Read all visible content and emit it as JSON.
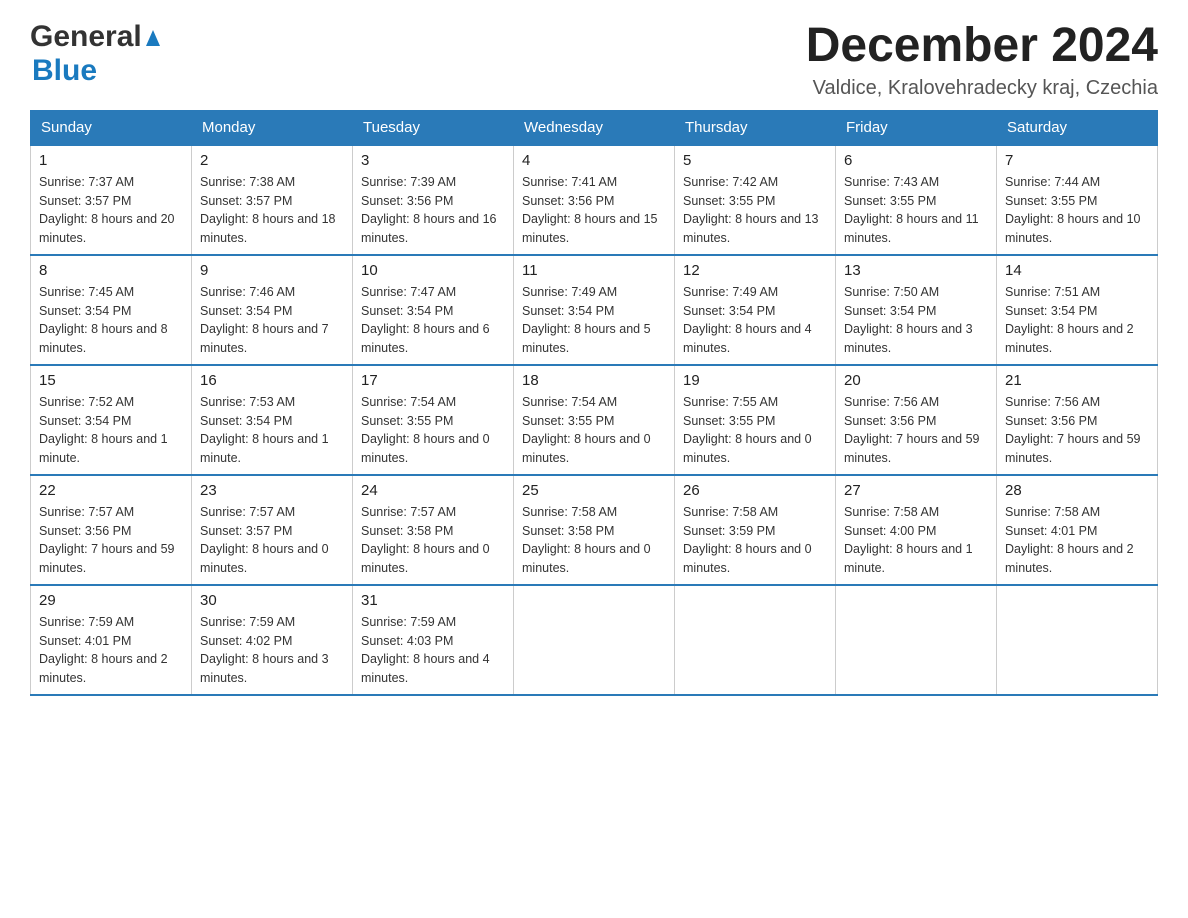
{
  "header": {
    "title": "December 2024",
    "location": "Valdice, Kralovehradecky kraj, Czechia",
    "logo_general": "General",
    "logo_blue": "Blue"
  },
  "days_of_week": [
    "Sunday",
    "Monday",
    "Tuesday",
    "Wednesday",
    "Thursday",
    "Friday",
    "Saturday"
  ],
  "weeks": [
    [
      {
        "day": "1",
        "sunrise": "7:37 AM",
        "sunset": "3:57 PM",
        "daylight": "8 hours and 20 minutes."
      },
      {
        "day": "2",
        "sunrise": "7:38 AM",
        "sunset": "3:57 PM",
        "daylight": "8 hours and 18 minutes."
      },
      {
        "day": "3",
        "sunrise": "7:39 AM",
        "sunset": "3:56 PM",
        "daylight": "8 hours and 16 minutes."
      },
      {
        "day": "4",
        "sunrise": "7:41 AM",
        "sunset": "3:56 PM",
        "daylight": "8 hours and 15 minutes."
      },
      {
        "day": "5",
        "sunrise": "7:42 AM",
        "sunset": "3:55 PM",
        "daylight": "8 hours and 13 minutes."
      },
      {
        "day": "6",
        "sunrise": "7:43 AM",
        "sunset": "3:55 PM",
        "daylight": "8 hours and 11 minutes."
      },
      {
        "day": "7",
        "sunrise": "7:44 AM",
        "sunset": "3:55 PM",
        "daylight": "8 hours and 10 minutes."
      }
    ],
    [
      {
        "day": "8",
        "sunrise": "7:45 AM",
        "sunset": "3:54 PM",
        "daylight": "8 hours and 8 minutes."
      },
      {
        "day": "9",
        "sunrise": "7:46 AM",
        "sunset": "3:54 PM",
        "daylight": "8 hours and 7 minutes."
      },
      {
        "day": "10",
        "sunrise": "7:47 AM",
        "sunset": "3:54 PM",
        "daylight": "8 hours and 6 minutes."
      },
      {
        "day": "11",
        "sunrise": "7:49 AM",
        "sunset": "3:54 PM",
        "daylight": "8 hours and 5 minutes."
      },
      {
        "day": "12",
        "sunrise": "7:49 AM",
        "sunset": "3:54 PM",
        "daylight": "8 hours and 4 minutes."
      },
      {
        "day": "13",
        "sunrise": "7:50 AM",
        "sunset": "3:54 PM",
        "daylight": "8 hours and 3 minutes."
      },
      {
        "day": "14",
        "sunrise": "7:51 AM",
        "sunset": "3:54 PM",
        "daylight": "8 hours and 2 minutes."
      }
    ],
    [
      {
        "day": "15",
        "sunrise": "7:52 AM",
        "sunset": "3:54 PM",
        "daylight": "8 hours and 1 minute."
      },
      {
        "day": "16",
        "sunrise": "7:53 AM",
        "sunset": "3:54 PM",
        "daylight": "8 hours and 1 minute."
      },
      {
        "day": "17",
        "sunrise": "7:54 AM",
        "sunset": "3:55 PM",
        "daylight": "8 hours and 0 minutes."
      },
      {
        "day": "18",
        "sunrise": "7:54 AM",
        "sunset": "3:55 PM",
        "daylight": "8 hours and 0 minutes."
      },
      {
        "day": "19",
        "sunrise": "7:55 AM",
        "sunset": "3:55 PM",
        "daylight": "8 hours and 0 minutes."
      },
      {
        "day": "20",
        "sunrise": "7:56 AM",
        "sunset": "3:56 PM",
        "daylight": "7 hours and 59 minutes."
      },
      {
        "day": "21",
        "sunrise": "7:56 AM",
        "sunset": "3:56 PM",
        "daylight": "7 hours and 59 minutes."
      }
    ],
    [
      {
        "day": "22",
        "sunrise": "7:57 AM",
        "sunset": "3:56 PM",
        "daylight": "7 hours and 59 minutes."
      },
      {
        "day": "23",
        "sunrise": "7:57 AM",
        "sunset": "3:57 PM",
        "daylight": "8 hours and 0 minutes."
      },
      {
        "day": "24",
        "sunrise": "7:57 AM",
        "sunset": "3:58 PM",
        "daylight": "8 hours and 0 minutes."
      },
      {
        "day": "25",
        "sunrise": "7:58 AM",
        "sunset": "3:58 PM",
        "daylight": "8 hours and 0 minutes."
      },
      {
        "day": "26",
        "sunrise": "7:58 AM",
        "sunset": "3:59 PM",
        "daylight": "8 hours and 0 minutes."
      },
      {
        "day": "27",
        "sunrise": "7:58 AM",
        "sunset": "4:00 PM",
        "daylight": "8 hours and 1 minute."
      },
      {
        "day": "28",
        "sunrise": "7:58 AM",
        "sunset": "4:01 PM",
        "daylight": "8 hours and 2 minutes."
      }
    ],
    [
      {
        "day": "29",
        "sunrise": "7:59 AM",
        "sunset": "4:01 PM",
        "daylight": "8 hours and 2 minutes."
      },
      {
        "day": "30",
        "sunrise": "7:59 AM",
        "sunset": "4:02 PM",
        "daylight": "8 hours and 3 minutes."
      },
      {
        "day": "31",
        "sunrise": "7:59 AM",
        "sunset": "4:03 PM",
        "daylight": "8 hours and 4 minutes."
      },
      null,
      null,
      null,
      null
    ]
  ]
}
